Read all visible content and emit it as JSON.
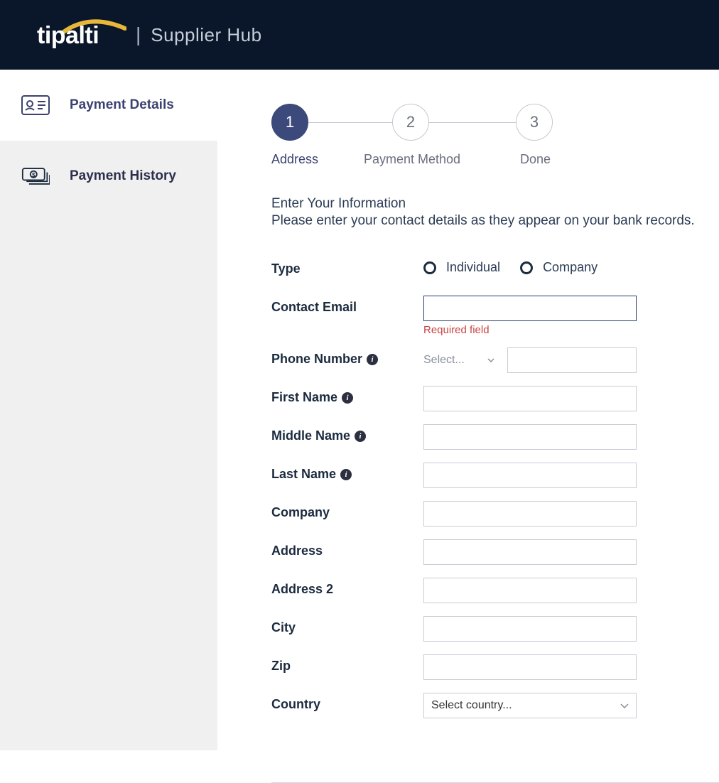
{
  "header": {
    "brand": "tipalti",
    "app_title": "Supplier Hub"
  },
  "sidebar": {
    "items": [
      {
        "label": "Payment Details"
      },
      {
        "label": "Payment History"
      }
    ]
  },
  "stepper": {
    "steps": [
      {
        "num": "1",
        "label": "Address"
      },
      {
        "num": "2",
        "label": "Payment Method"
      },
      {
        "num": "3",
        "label": "Done"
      }
    ]
  },
  "intro": {
    "title": "Enter Your Information",
    "subtitle": "Please enter your contact details as they appear on your bank records."
  },
  "form": {
    "type_label": "Type",
    "type_options": {
      "individual": "Individual",
      "company": "Company"
    },
    "contact_email_label": "Contact Email",
    "contact_email_value": "",
    "contact_email_error": "Required field",
    "phone_label": "Phone Number",
    "phone_select_placeholder": "Select...",
    "phone_value": "",
    "first_name_label": "First Name",
    "first_name_value": "",
    "middle_name_label": "Middle Name",
    "middle_name_value": "",
    "last_name_label": "Last Name",
    "last_name_value": "",
    "company_label": "Company",
    "company_value": "",
    "address_label": "Address",
    "address_value": "",
    "address2_label": "Address 2",
    "address2_value": "",
    "city_label": "City",
    "city_value": "",
    "zip_label": "Zip",
    "zip_value": "",
    "country_label": "Country",
    "country_placeholder": "Select country..."
  }
}
